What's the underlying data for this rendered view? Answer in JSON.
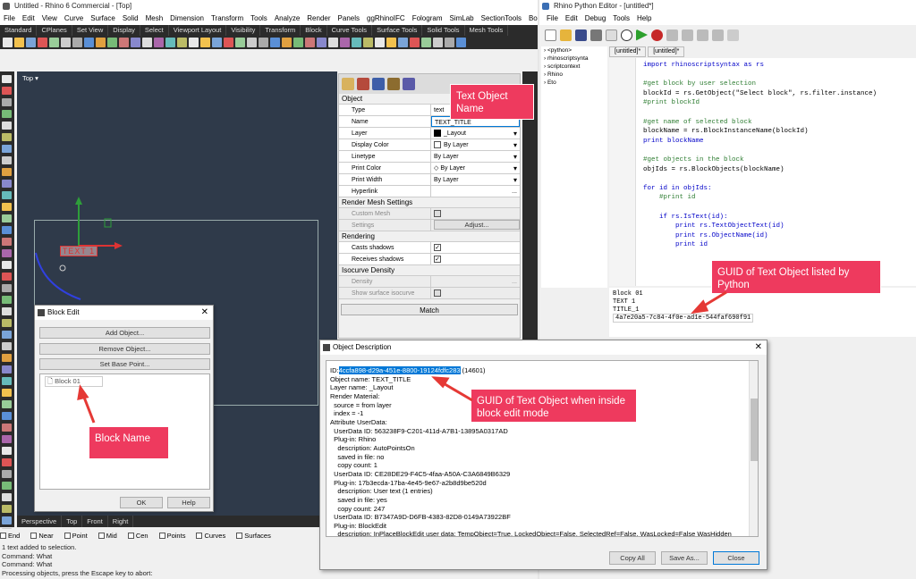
{
  "rhino": {
    "title": "Untitled - Rhino 6 Commercial - [Top]",
    "menu": [
      "File",
      "Edit",
      "View",
      "Curve",
      "Surface",
      "Solid",
      "Mesh",
      "Dimension",
      "Transform",
      "Tools",
      "Analyze",
      "Render",
      "Panels",
      "ggRhinoIFC",
      "Fologram",
      "SimLab",
      "SectionTools",
      "BoltGen",
      "Help"
    ],
    "toolbar_tabs": [
      "Standard",
      "CPlanes",
      "Set View",
      "Display",
      "Select",
      "Viewport Layout",
      "Visibility",
      "Transform",
      "Block",
      "Curve Tools",
      "Surface Tools",
      "Solid Tools",
      "Mesh Tools"
    ],
    "viewport_title": "Top",
    "viewport_text": "TEXT 1",
    "view_tabs": [
      "Perspective",
      "Top",
      "Front",
      "Right"
    ],
    "osnaps": [
      "End",
      "Near",
      "Point",
      "Mid",
      "Cen",
      "Points",
      "Curves",
      "Surfaces"
    ],
    "command_history": [
      "1 text added to selection.",
      "Command: What",
      "Command: What",
      "Processing objects, press the Escape key to abort:"
    ]
  },
  "properties": {
    "section_object": "Object",
    "rows": [
      {
        "k": "Type",
        "v": "text"
      },
      {
        "k": "Name",
        "v": "TEXT_TITLE"
      },
      {
        "k": "Layer",
        "v": "_Layout"
      },
      {
        "k": "Display Color",
        "v": "By Layer"
      },
      {
        "k": "Linetype",
        "v": "By Layer"
      },
      {
        "k": "Print Color",
        "v": "By Layer"
      },
      {
        "k": "Print Width",
        "v": "By Layer"
      },
      {
        "k": "Hyperlink",
        "v": ""
      }
    ],
    "section_render_mesh": "Render Mesh Settings",
    "custom_mesh": "Custom Mesh",
    "settings": "Settings",
    "adjust": "Adjust...",
    "section_rendering": "Rendering",
    "casts_shadows": "Casts shadows",
    "receives_shadows": "Receives shadows",
    "section_isocurve": "Isocurve Density",
    "density": "Density",
    "show_surface_isocurve": "Show surface isocurve",
    "match": "Match"
  },
  "block_edit": {
    "title": "Block Edit",
    "add_object": "Add Object...",
    "remove_object": "Remove Object...",
    "set_base_point": "Set Base Point...",
    "block_item": "Block 01",
    "ok": "OK",
    "help": "Help"
  },
  "python": {
    "title": "Rhino Python Editor - [untitled*]",
    "menu": [
      "File",
      "Edit",
      "Debug",
      "Tools",
      "Help"
    ],
    "tree": [
      "<python>",
      "rhinoscriptsynta",
      "scriptcontext",
      "Rhino",
      "Eto"
    ],
    "tabs": [
      "[untitled]*",
      "[untitled]*"
    ],
    "code": [
      "import rhinoscriptsyntax as rs",
      "",
      "#get block by user selection",
      "blockId = rs.GetObject(\"Select block\", rs.filter.instance)",
      "#print blockId",
      "",
      "#get name of selected block",
      "blockName = rs.BlockInstanceName(blockId)",
      "print blockName",
      "",
      "#get objects in the block",
      "objIds = rs.BlockObjects(blockName)",
      "",
      "for id in objIds:",
      "    #print id",
      "",
      "    if rs.IsText(id):",
      "        print rs.TextObjectText(id)",
      "        print rs.ObjectName(id)",
      "        print id",
      ""
    ],
    "output": [
      "Block 01",
      "TEXT 1",
      "TITLE_1"
    ],
    "output_guid": "4a7e20a5-7c84-4f0e-ad1e-544faf690f91"
  },
  "object_description": {
    "title": "Object Description",
    "id_prefix": "ID:",
    "id_guid": "4ccfa898-d29a-451e-8800-19124fdfc283",
    "id_suffix": " (14601)",
    "lines": [
      "Object name: TEXT_TITLE",
      "Layer name: _Layout",
      "Render Material:",
      "  source = from layer",
      "  index = -1",
      "Attribute UserData:",
      "  UserData ID: 563238F9-C201-411d-A7B1-13895A0317AD",
      "  Plug-in: Rhino",
      "    description: AutoPointsOn",
      "    saved in file: no",
      "    copy count: 1",
      "  UserData ID: CE28DE29-F4C5-4faa-A50A-C3A6849B6329",
      "  Plug-in: 17b3ecda-17ba-4e45-9e67-a2b8d9be520d",
      "    description: User text (1 entries)",
      "    saved in file: yes",
      "    copy count: 247",
      "  UserData ID: B7347A9D-D6FB-4383-82D8-0149A73922BF",
      "  Plug-in: BlockEdit",
      "    description: InPlaceBlockEdit user data; TempObject=True, LockedObject=False, SelectedRef=False, WasLocked=False WasHidden"
    ],
    "copy_all": "Copy All",
    "save_as": "Save As...",
    "close": "Close"
  },
  "callouts": {
    "text_object_name": "Text Object Name",
    "guid_python": "GUID of Text Object listed by Python",
    "guid_block_edit": "GUID of Text Object when inside block edit mode",
    "block_name": "Block Name"
  },
  "colors": {
    "callout": "#ee3a5e",
    "viewport": "#2f3a4a",
    "selection": "#0078d7"
  }
}
